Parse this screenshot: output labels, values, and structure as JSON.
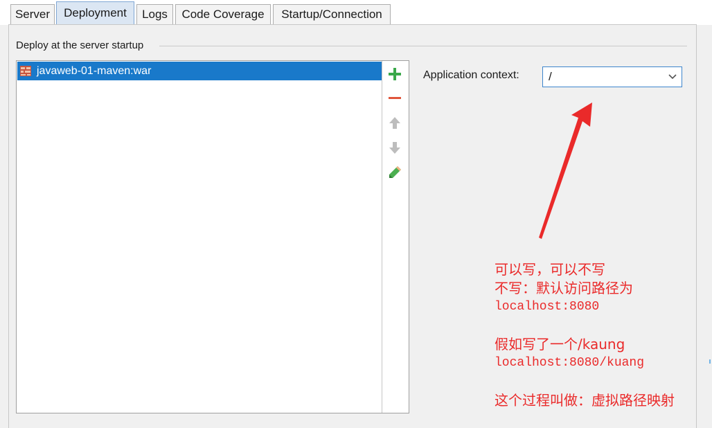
{
  "tabs": [
    {
      "label": "Server",
      "active": false
    },
    {
      "label": "Deployment",
      "active": true
    },
    {
      "label": "Logs",
      "active": false
    },
    {
      "label": "Code Coverage",
      "active": false
    },
    {
      "label": "Startup/Connection",
      "active": false
    }
  ],
  "deploy_group": {
    "title": "Deploy at the server startup",
    "artifacts": [
      {
        "label": "javaweb-01-maven:war",
        "icon": "war-artifact-icon",
        "selected": true
      }
    ]
  },
  "toolbar": {
    "add_icon": "plus-icon",
    "remove_icon": "minus-icon",
    "move_up_icon": "arrow-up-icon",
    "move_down_icon": "arrow-down-icon",
    "edit_icon": "pencil-icon"
  },
  "application_context": {
    "label": "Application context:",
    "value": "/"
  },
  "annotation": {
    "line1": "可以写，可以不写",
    "line2": "不写：默认访问路径为",
    "line3": "localhost:8080",
    "line4": "假如写了一个/kaung",
    "line5": "localhost:8080/kuang",
    "line6": "这个过程叫做：虚拟路径映射"
  },
  "colors": {
    "selection": "#1979ca",
    "annotation_red": "#ea2a2a",
    "add_green": "#3aa84a",
    "remove_red": "#e0553b",
    "focus_border": "#3c84cc"
  }
}
